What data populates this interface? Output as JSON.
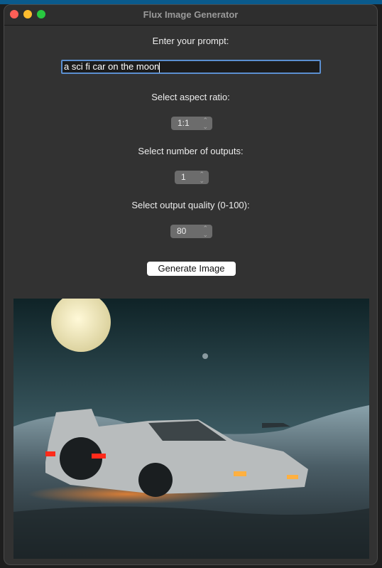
{
  "window": {
    "title": "Flux Image Generator"
  },
  "form": {
    "prompt_label": "Enter your prompt:",
    "prompt_value": "a sci fi car on the moon",
    "aspect_label": "Select aspect ratio:",
    "aspect_value": "1:1",
    "outputs_label": "Select number of outputs:",
    "outputs_value": "1",
    "quality_label": "Select output quality (0-100):",
    "quality_value": "80",
    "generate_label": "Generate Image"
  },
  "output": {
    "image_subject": "sci-fi car on the moon"
  },
  "colors": {
    "accent": "#5b8fd0",
    "close": "#ff5f57",
    "minimize": "#febc2e",
    "zoom": "#28c840"
  }
}
